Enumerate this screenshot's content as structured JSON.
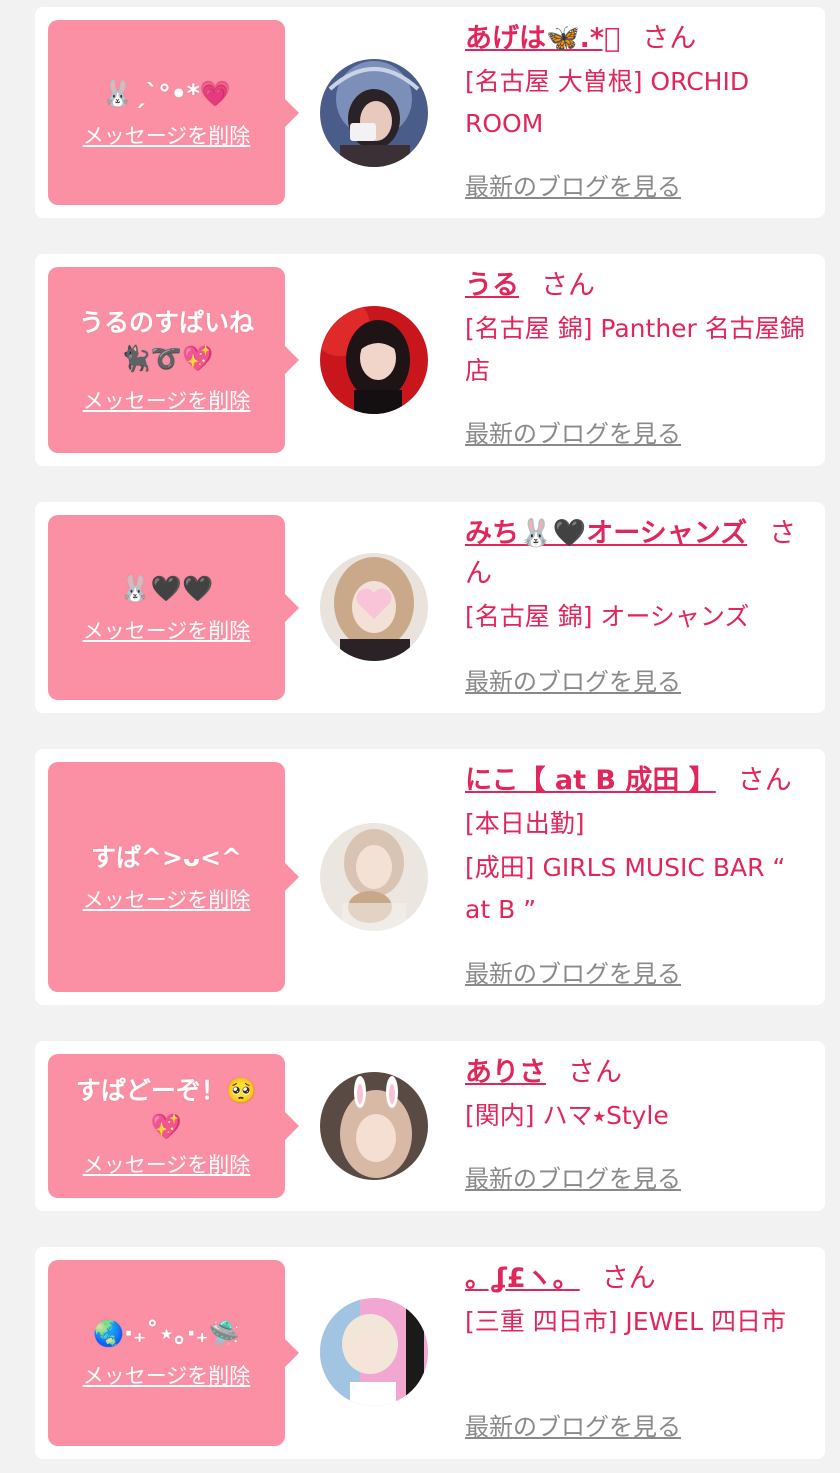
{
  "delete_label": "メッセージを削除",
  "blog_label": "最新のブログを見る",
  "san_label": "さん",
  "accent_color": "#e0265a",
  "bubble_color": "#fb90a4",
  "items": [
    {
      "message": "🐰ˏˋ°•*💗",
      "name": "あげは🦋.*ﾟ",
      "shop": "[名古屋 大曽根] ORCHID ROOM",
      "extra": ""
    },
    {
      "message": "うるのすぱいね 🐈‍⬛➰💖",
      "name": "うる",
      "shop": "[名古屋 錦] Panther 名古屋錦店",
      "extra": ""
    },
    {
      "message": "🐰🖤🖤",
      "name": "みち🐰🖤オーシャンズ",
      "shop": "[名古屋 錦] オーシャンズ",
      "extra": ""
    },
    {
      "message": "すぱ^>ᴗ<^",
      "name": "にこ【 at B 成田 】",
      "shop": "[成田] GIRLS MUSIC BAR “ at B ”",
      "extra": "[本日出勤]"
    },
    {
      "message": "すぱどーぞ！🥺💖",
      "name": "ありさ",
      "shop": "[関内] ハマ⭑Style",
      "extra": ""
    },
    {
      "message": "🌏‧₊˚⋆｡‧₊🛸",
      "name": "。ʆ£ヽ。",
      "shop": "[三重 四日市] JEWEL 四日市",
      "extra": ""
    }
  ]
}
